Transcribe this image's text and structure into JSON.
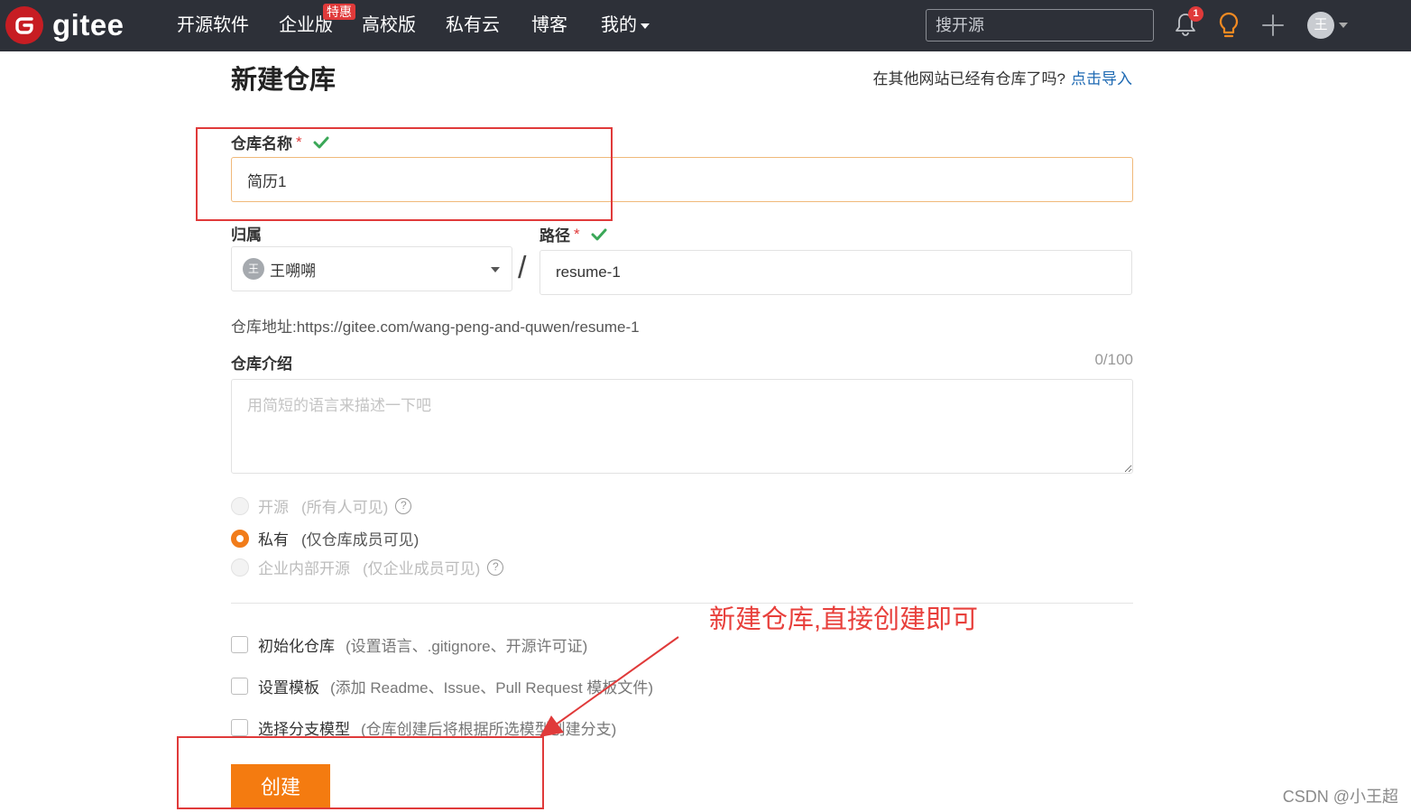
{
  "navbar": {
    "brand": "gitee",
    "items": [
      {
        "label": "开源软件"
      },
      {
        "label": "企业版"
      },
      {
        "label": "高校版"
      },
      {
        "label": "私有云"
      },
      {
        "label": "博客"
      },
      {
        "label": "我的"
      }
    ],
    "enterprise_badge": "特惠",
    "search_placeholder": "搜开源",
    "notification_count": "1",
    "avatar_initial": "王"
  },
  "page": {
    "title": "新建仓库",
    "import_prompt": "在其他网站已经有仓库了吗?",
    "import_link": "点击导入"
  },
  "form": {
    "name_label": "仓库名称",
    "required_mark": "*",
    "name_value": "简历1",
    "owner_label": "归属",
    "owner_avatar": "王",
    "owner_value": "王嗍嗍",
    "slash": "/",
    "path_label": "路径",
    "path_value": "resume-1",
    "repo_url": "仓库地址:https://gitee.com/wang-peng-and-quwen/resume-1",
    "desc_label": "仓库介绍",
    "desc_counter": "0/100",
    "desc_placeholder": "用简短的语言来描述一下吧",
    "visibility": [
      {
        "label": "开源",
        "sub": "(所有人可见)",
        "selected": false,
        "disabled": true,
        "help": "?"
      },
      {
        "label": "私有",
        "sub": "(仅仓库成员可见)",
        "selected": true,
        "disabled": false,
        "help": ""
      },
      {
        "label": "企业内部开源",
        "sub": "(仅企业成员可见)",
        "selected": false,
        "disabled": true,
        "help": "?"
      }
    ],
    "options": [
      {
        "label": "初始化仓库",
        "sub": "(设置语言、.gitignore、开源许可证)"
      },
      {
        "label": "设置模板",
        "sub": "(添加 Readme、Issue、Pull Request 模板文件)"
      },
      {
        "label": "选择分支模型",
        "sub": "(仓库创建后将根据所选模型创建分支)"
      }
    ],
    "submit_label": "创建"
  },
  "annotation": {
    "note": "新建仓库,直接创建即可",
    "color": "#e03a3a"
  },
  "watermark": "CSDN @小王超",
  "colors": {
    "navbar_bg": "#2d3038",
    "brand_red": "#c71d23",
    "accent_orange": "#f47b10",
    "link_blue": "#1f6ab3",
    "ok_green": "#3aa757"
  }
}
